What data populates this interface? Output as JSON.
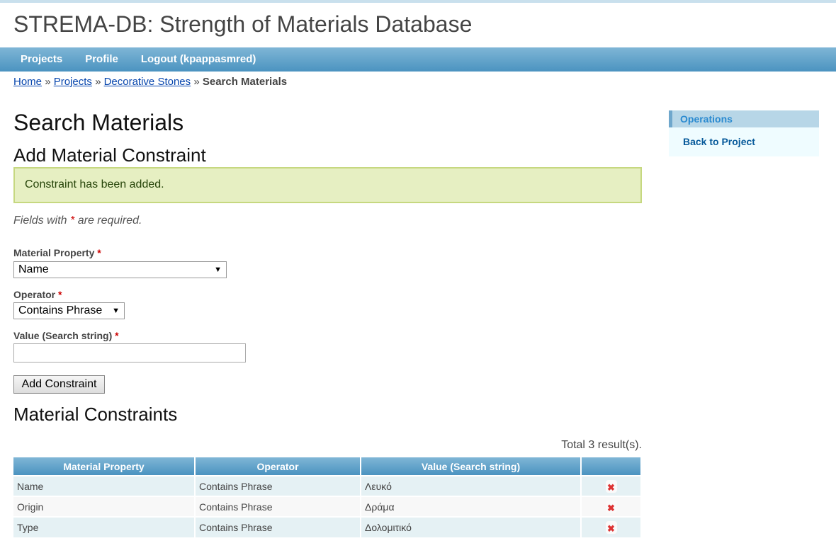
{
  "site_title": "STREMA-DB: Strength of Materials Database",
  "nav": [
    "Projects",
    "Profile",
    "Logout (kpappasmred)"
  ],
  "breadcrumb": {
    "links": [
      "Home",
      "Projects",
      "Decorative Stones"
    ],
    "sep": "»",
    "current": "Search Materials"
  },
  "page_title": "Search Materials",
  "form_title": "Add Material Constraint",
  "flash": "Constraint has been added.",
  "required_note": {
    "pre": "Fields with ",
    "star": "*",
    "post": " are required."
  },
  "fields": {
    "property_label": "Material Property",
    "property_value": "Name",
    "operator_label": "Operator",
    "operator_value": "Contains Phrase",
    "value_label": "Value (Search string)",
    "value_value": "",
    "star": "*"
  },
  "add_button": "Add Constraint",
  "constraints_title": "Material Constraints",
  "total": "Total 3 result(s).",
  "table": {
    "headers": [
      "Material Property",
      "Operator",
      "Value (Search string)",
      ""
    ],
    "rows": [
      [
        "Name",
        "Contains Phrase",
        "Λευκό"
      ],
      [
        "Origin",
        "Contains Phrase",
        "Δράμα"
      ],
      [
        "Type",
        "Contains Phrase",
        "Δολομιτικό"
      ]
    ],
    "delete_icon": "delete-x-icon"
  },
  "sidebar": {
    "title": "Operations",
    "items": [
      "Back to Project"
    ]
  },
  "colors": {
    "nav": "#4b93c0",
    "flash_bg": "#e6efc2",
    "link": "#0645ad"
  }
}
